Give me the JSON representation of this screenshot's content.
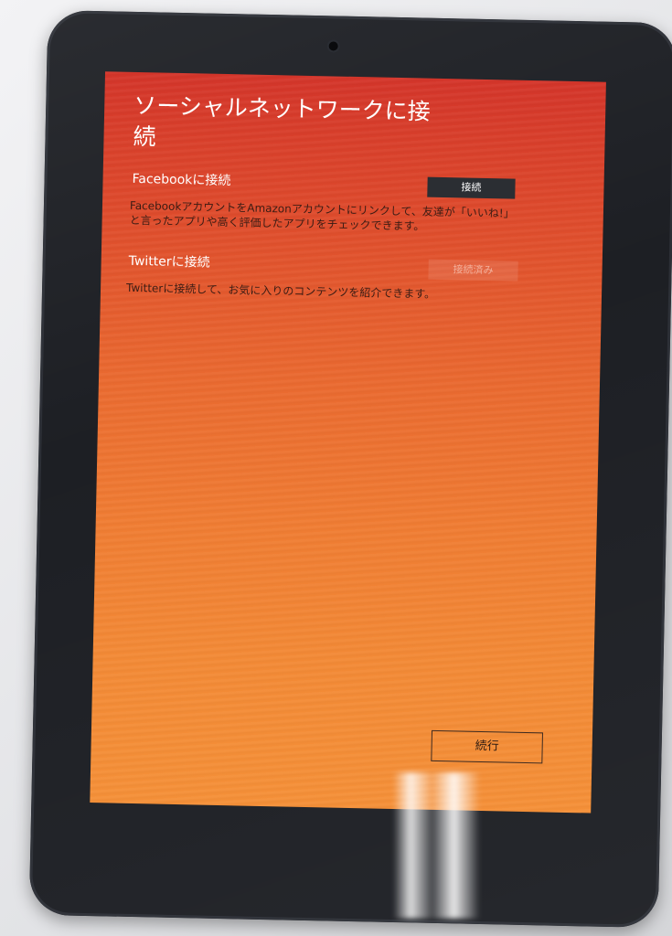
{
  "screen": {
    "title": "ソーシャルネットワークに接続",
    "facebook": {
      "heading": "Facebookに接続",
      "description": "FacebookアカウントをAmazonアカウントにリンクして、友達が「いいね!」と言ったアプリや高く評価したアプリをチェックできます。",
      "button_label": "接続"
    },
    "twitter": {
      "heading": "Twitterに接続",
      "description": "Twitterに接続して、お気に入りのコンテンツを紹介できます。",
      "button_label": "接続済み"
    },
    "continue_label": "続行"
  },
  "colors": {
    "screen_top": "#d4352a",
    "screen_bottom": "#f59038",
    "button_dark": "#2b2e33",
    "bezel": "#1d1f24"
  }
}
